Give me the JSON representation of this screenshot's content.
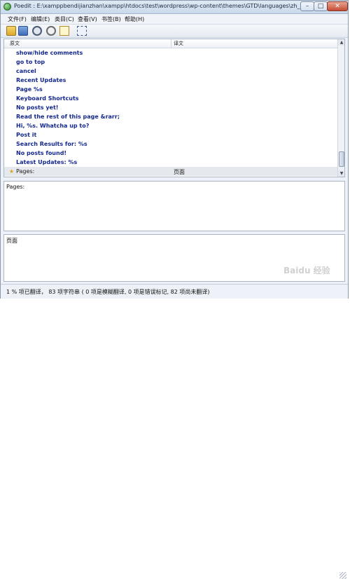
{
  "window": {
    "title": "Poedit : E:\\xamppbendijianzhan\\xampp\\htdocs\\test\\wordpress\\wp-content\\themes\\GTD\\languages\\zh_CN.po",
    "min_glyph": "–",
    "max_glyph": "□",
    "close_glyph": "✕"
  },
  "menu": {
    "items": [
      "文件(F)",
      "编辑(E)",
      "类目(C)",
      "查看(V)",
      "书签(B)",
      "帮助(H)"
    ]
  },
  "toolbar": {
    "icons": [
      "open-icon",
      "save-icon",
      "update-icon",
      "catalog-manager-icon",
      "edit-comment-icon",
      "fullscreen-icon"
    ]
  },
  "list": {
    "headers": {
      "source": "原文",
      "translation": "译文"
    },
    "rows": [
      {
        "source": "show/hide comments",
        "translation": ""
      },
      {
        "source": "go to top",
        "translation": ""
      },
      {
        "source": "cancel",
        "translation": ""
      },
      {
        "source": "Recent Updates",
        "translation": ""
      },
      {
        "source": "Page %s",
        "translation": ""
      },
      {
        "source": "Keyboard Shortcuts",
        "translation": ""
      },
      {
        "source": "No posts yet!",
        "translation": ""
      },
      {
        "source": "Read the rest of this page &rarr;",
        "translation": ""
      },
      {
        "source": "Hi, %s. Whatcha up to?",
        "translation": ""
      },
      {
        "source": "Post it",
        "translation": ""
      },
      {
        "source": "Search Results for: %s",
        "translation": ""
      },
      {
        "source": "No posts found!",
        "translation": ""
      },
      {
        "source": "Latest Updates: %s",
        "translation": ""
      },
      {
        "source": "Pages:",
        "translation": "页面",
        "selected": true
      }
    ],
    "scroll_up": "▲",
    "scroll_down": "▼"
  },
  "editor": {
    "source_text": "Pages:",
    "translation_text": "页面"
  },
  "status": {
    "text": "1 % 项已翻译， 83 项字符串 ( 0 项是模糊翻译, 0 项是错误标记, 82 项尚未翻译)"
  },
  "watermark": "Baidu 经验"
}
